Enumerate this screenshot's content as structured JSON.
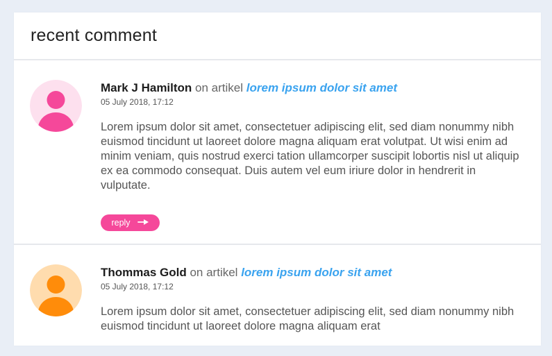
{
  "panel": {
    "title": "recent comment"
  },
  "comments": [
    {
      "author": "Mark J Hamilton",
      "on_text": "on artikel",
      "article": "lorem ipsum dolor sit amet",
      "timestamp": "05 July 2018, 17:12",
      "text": "Lorem ipsum dolor sit amet, consectetuer adipiscing elit, sed diam nonummy nibh euismod tincidunt ut laoreet dolore magna aliquam erat volutpat. Ut wisi enim ad minim veniam, quis nostrud exerci tation ullamcorper suscipit lobortis nisl ut aliquip ex ea commodo consequat. Duis autem vel eum iriure dolor in hendrerit in vulputate.",
      "reply_label": "reply",
      "avatar_icon": "user-icon",
      "avatar_bg": "#fde0ee",
      "avatar_fg": "#f5489a",
      "reply_color": "#f5489a"
    },
    {
      "author": "Thommas Gold",
      "on_text": "on artikel",
      "article": "lorem ipsum dolor sit amet",
      "timestamp": "05 July 2018, 17:12",
      "text": "Lorem ipsum dolor sit amet, consectetuer adipiscing elit, sed diam nonummy nibh euismod tincidunt ut laoreet dolore magna aliquam erat",
      "avatar_icon": "user-icon",
      "avatar_bg": "#ffdcae",
      "avatar_fg": "#ff8c0a"
    }
  ],
  "colors": {
    "link": "#3aa3ef",
    "background": "#e9eef6",
    "divider": "#e6e8ec"
  }
}
